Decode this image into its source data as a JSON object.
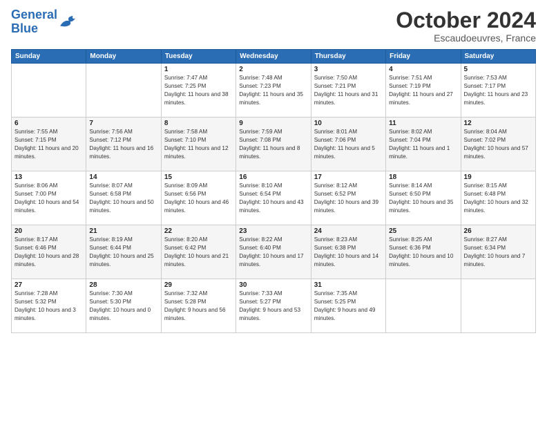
{
  "header": {
    "logo_line1": "General",
    "logo_line2": "Blue",
    "month": "October 2024",
    "location": "Escaudoeuvres, France"
  },
  "weekdays": [
    "Sunday",
    "Monday",
    "Tuesday",
    "Wednesday",
    "Thursday",
    "Friday",
    "Saturday"
  ],
  "weeks": [
    [
      {
        "day": "",
        "info": ""
      },
      {
        "day": "",
        "info": ""
      },
      {
        "day": "1",
        "info": "Sunrise: 7:47 AM\nSunset: 7:25 PM\nDaylight: 11 hours and 38 minutes."
      },
      {
        "day": "2",
        "info": "Sunrise: 7:48 AM\nSunset: 7:23 PM\nDaylight: 11 hours and 35 minutes."
      },
      {
        "day": "3",
        "info": "Sunrise: 7:50 AM\nSunset: 7:21 PM\nDaylight: 11 hours and 31 minutes."
      },
      {
        "day": "4",
        "info": "Sunrise: 7:51 AM\nSunset: 7:19 PM\nDaylight: 11 hours and 27 minutes."
      },
      {
        "day": "5",
        "info": "Sunrise: 7:53 AM\nSunset: 7:17 PM\nDaylight: 11 hours and 23 minutes."
      }
    ],
    [
      {
        "day": "6",
        "info": "Sunrise: 7:55 AM\nSunset: 7:15 PM\nDaylight: 11 hours and 20 minutes."
      },
      {
        "day": "7",
        "info": "Sunrise: 7:56 AM\nSunset: 7:12 PM\nDaylight: 11 hours and 16 minutes."
      },
      {
        "day": "8",
        "info": "Sunrise: 7:58 AM\nSunset: 7:10 PM\nDaylight: 11 hours and 12 minutes."
      },
      {
        "day": "9",
        "info": "Sunrise: 7:59 AM\nSunset: 7:08 PM\nDaylight: 11 hours and 8 minutes."
      },
      {
        "day": "10",
        "info": "Sunrise: 8:01 AM\nSunset: 7:06 PM\nDaylight: 11 hours and 5 minutes."
      },
      {
        "day": "11",
        "info": "Sunrise: 8:02 AM\nSunset: 7:04 PM\nDaylight: 11 hours and 1 minute."
      },
      {
        "day": "12",
        "info": "Sunrise: 8:04 AM\nSunset: 7:02 PM\nDaylight: 10 hours and 57 minutes."
      }
    ],
    [
      {
        "day": "13",
        "info": "Sunrise: 8:06 AM\nSunset: 7:00 PM\nDaylight: 10 hours and 54 minutes."
      },
      {
        "day": "14",
        "info": "Sunrise: 8:07 AM\nSunset: 6:58 PM\nDaylight: 10 hours and 50 minutes."
      },
      {
        "day": "15",
        "info": "Sunrise: 8:09 AM\nSunset: 6:56 PM\nDaylight: 10 hours and 46 minutes."
      },
      {
        "day": "16",
        "info": "Sunrise: 8:10 AM\nSunset: 6:54 PM\nDaylight: 10 hours and 43 minutes."
      },
      {
        "day": "17",
        "info": "Sunrise: 8:12 AM\nSunset: 6:52 PM\nDaylight: 10 hours and 39 minutes."
      },
      {
        "day": "18",
        "info": "Sunrise: 8:14 AM\nSunset: 6:50 PM\nDaylight: 10 hours and 35 minutes."
      },
      {
        "day": "19",
        "info": "Sunrise: 8:15 AM\nSunset: 6:48 PM\nDaylight: 10 hours and 32 minutes."
      }
    ],
    [
      {
        "day": "20",
        "info": "Sunrise: 8:17 AM\nSunset: 6:46 PM\nDaylight: 10 hours and 28 minutes."
      },
      {
        "day": "21",
        "info": "Sunrise: 8:19 AM\nSunset: 6:44 PM\nDaylight: 10 hours and 25 minutes."
      },
      {
        "day": "22",
        "info": "Sunrise: 8:20 AM\nSunset: 6:42 PM\nDaylight: 10 hours and 21 minutes."
      },
      {
        "day": "23",
        "info": "Sunrise: 8:22 AM\nSunset: 6:40 PM\nDaylight: 10 hours and 17 minutes."
      },
      {
        "day": "24",
        "info": "Sunrise: 8:23 AM\nSunset: 6:38 PM\nDaylight: 10 hours and 14 minutes."
      },
      {
        "day": "25",
        "info": "Sunrise: 8:25 AM\nSunset: 6:36 PM\nDaylight: 10 hours and 10 minutes."
      },
      {
        "day": "26",
        "info": "Sunrise: 8:27 AM\nSunset: 6:34 PM\nDaylight: 10 hours and 7 minutes."
      }
    ],
    [
      {
        "day": "27",
        "info": "Sunrise: 7:28 AM\nSunset: 5:32 PM\nDaylight: 10 hours and 3 minutes."
      },
      {
        "day": "28",
        "info": "Sunrise: 7:30 AM\nSunset: 5:30 PM\nDaylight: 10 hours and 0 minutes."
      },
      {
        "day": "29",
        "info": "Sunrise: 7:32 AM\nSunset: 5:28 PM\nDaylight: 9 hours and 56 minutes."
      },
      {
        "day": "30",
        "info": "Sunrise: 7:33 AM\nSunset: 5:27 PM\nDaylight: 9 hours and 53 minutes."
      },
      {
        "day": "31",
        "info": "Sunrise: 7:35 AM\nSunset: 5:25 PM\nDaylight: 9 hours and 49 minutes."
      },
      {
        "day": "",
        "info": ""
      },
      {
        "day": "",
        "info": ""
      }
    ]
  ]
}
